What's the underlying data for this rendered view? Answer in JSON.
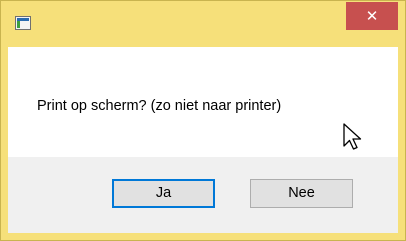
{
  "window": {
    "title": "",
    "close_glyph": "✕"
  },
  "dialog": {
    "message": "Print op scherm? (zo niet naar printer)"
  },
  "buttons": {
    "yes_label": "Ja",
    "no_label": "Nee"
  },
  "colors": {
    "titlebar": "#f6e07a",
    "close_button": "#c7504f",
    "focus_border": "#0078d7"
  },
  "icons": {
    "app": "application-window-icon",
    "cursor": "mouse-pointer-icon"
  }
}
